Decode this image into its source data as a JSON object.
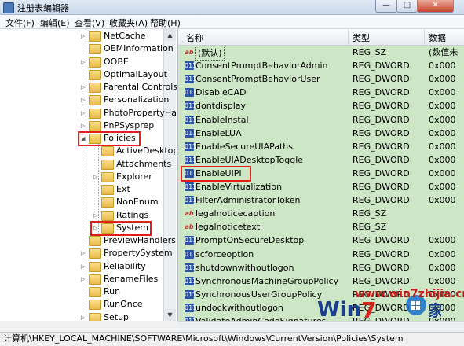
{
  "window": {
    "title": "注册表编辑器",
    "min_glyph": "—",
    "max_glyph": "□",
    "close_glyph": "✕"
  },
  "menu": [
    "文件(F)",
    "编辑(E)",
    "查看(V)",
    "收藏夹(A)",
    "帮助(H)"
  ],
  "tree": {
    "items": [
      {
        "label": "NetCache",
        "level": 0,
        "expander": "▷"
      },
      {
        "label": "OEMInformation",
        "level": 0,
        "expander": ""
      },
      {
        "label": "OOBE",
        "level": 0,
        "expander": "▷"
      },
      {
        "label": "OptimalLayout",
        "level": 0,
        "expander": ""
      },
      {
        "label": "Parental Controls",
        "level": 0,
        "expander": "▷"
      },
      {
        "label": "Personalization",
        "level": 0,
        "expander": "▷"
      },
      {
        "label": "PhotoPropertyHa",
        "level": 0,
        "expander": "▷"
      },
      {
        "label": "PnPSysprep",
        "level": 0,
        "expander": "▷"
      },
      {
        "label": "Policies",
        "level": 0,
        "expander": "◢",
        "highlight": true
      },
      {
        "label": "ActiveDesktop",
        "level": 1,
        "expander": ""
      },
      {
        "label": "Attachments",
        "level": 1,
        "expander": ""
      },
      {
        "label": "Explorer",
        "level": 1,
        "expander": "▷"
      },
      {
        "label": "Ext",
        "level": 1,
        "expander": ""
      },
      {
        "label": "NonEnum",
        "level": 1,
        "expander": ""
      },
      {
        "label": "Ratings",
        "level": 1,
        "expander": "▷"
      },
      {
        "label": "System",
        "level": 1,
        "expander": "▷",
        "highlight": true,
        "selected": true
      },
      {
        "label": "PreviewHandlers",
        "level": 0,
        "expander": ""
      },
      {
        "label": "PropertySystem",
        "level": 0,
        "expander": "▷"
      },
      {
        "label": "Reliability",
        "level": 0,
        "expander": "▷"
      },
      {
        "label": "RenameFiles",
        "level": 0,
        "expander": "▷"
      },
      {
        "label": "Run",
        "level": 0,
        "expander": ""
      },
      {
        "label": "RunOnce",
        "level": 0,
        "expander": ""
      },
      {
        "label": "Setup",
        "level": 0,
        "expander": "▷"
      }
    ]
  },
  "list": {
    "columns": {
      "name": "名称",
      "type": "类型",
      "data": "数据"
    },
    "rows": [
      {
        "name": "(默认)",
        "type": "REG_SZ",
        "data": "(数值未",
        "icon": "ab",
        "kind": "sz",
        "is_default": true
      },
      {
        "name": "ConsentPromptBehaviorAdmin",
        "type": "REG_DWORD",
        "data": "0x000",
        "icon": "011",
        "kind": "dword"
      },
      {
        "name": "ConsentPromptBehaviorUser",
        "type": "REG_DWORD",
        "data": "0x000",
        "icon": "011",
        "kind": "dword"
      },
      {
        "name": "DisableCAD",
        "type": "REG_DWORD",
        "data": "0x000",
        "icon": "011",
        "kind": "dword"
      },
      {
        "name": "dontdisplay",
        "type": "REG_DWORD",
        "data": "0x000",
        "icon": "011",
        "kind": "dword"
      },
      {
        "name": "EnableInstal",
        "type": "REG_DWORD",
        "data": "0x000",
        "icon": "011",
        "kind": "dword"
      },
      {
        "name": "EnableLUA",
        "type": "REG_DWORD",
        "data": "0x000",
        "icon": "011",
        "kind": "dword"
      },
      {
        "name": "EnableSecureUIAPaths",
        "type": "REG_DWORD",
        "data": "0x000",
        "icon": "011",
        "kind": "dword"
      },
      {
        "name": "EnableUIADesktopToggle",
        "type": "REG_DWORD",
        "data": "0x000",
        "icon": "011",
        "kind": "dword"
      },
      {
        "name": "EnableUIPI",
        "type": "REG_DWORD",
        "data": "0x000",
        "icon": "011",
        "kind": "dword",
        "highlight": true
      },
      {
        "name": "EnableVirtualization",
        "type": "REG_DWORD",
        "data": "0x000",
        "icon": "011",
        "kind": "dword"
      },
      {
        "name": "FilterAdministratorToken",
        "type": "REG_DWORD",
        "data": "0x000",
        "icon": "011",
        "kind": "dword"
      },
      {
        "name": "legalnoticecaption",
        "type": "REG_SZ",
        "data": "",
        "icon": "ab",
        "kind": "sz"
      },
      {
        "name": "legalnoticetext",
        "type": "REG_SZ",
        "data": "",
        "icon": "ab",
        "kind": "sz"
      },
      {
        "name": "PromptOnSecureDesktop",
        "type": "REG_DWORD",
        "data": "0x000",
        "icon": "011",
        "kind": "dword"
      },
      {
        "name": "scforceoption",
        "type": "REG_DWORD",
        "data": "0x000",
        "icon": "011",
        "kind": "dword"
      },
      {
        "name": "shutdownwithoutlogon",
        "type": "REG_DWORD",
        "data": "0x000",
        "icon": "011",
        "kind": "dword"
      },
      {
        "name": "SynchronousMachineGroupPolicy",
        "type": "REG_DWORD",
        "data": "0x000",
        "icon": "011",
        "kind": "dword"
      },
      {
        "name": "SynchronousUserGroupPolicy",
        "type": "REG_DWORD",
        "data": "0x000",
        "icon": "011",
        "kind": "dword"
      },
      {
        "name": "undockwithoutlogon",
        "type": "REG_DWORD",
        "data": "0x000",
        "icon": "011",
        "kind": "dword"
      },
      {
        "name": "ValidateAdminCodeSignatures",
        "type": "REG_DWORD",
        "data": "0x000",
        "icon": "011",
        "kind": "dword"
      }
    ]
  },
  "status": {
    "path": "计算机\\HKEY_LOCAL_MACHINE\\SOFTWARE\\Microsoft\\Windows\\CurrentVersion\\Policies\\System"
  },
  "watermark": {
    "text": "www.win7zhijia.cn"
  },
  "colors": {
    "list_background": "#cde7c6",
    "highlight": "#e0201a",
    "dword_icon": "#2a54a8"
  }
}
